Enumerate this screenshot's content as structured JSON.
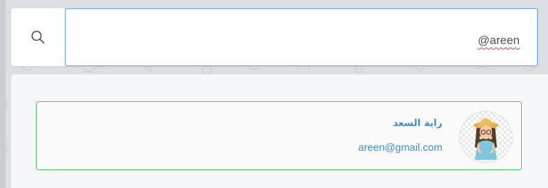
{
  "search": {
    "query": "@areen",
    "icon": "search-icon"
  },
  "results": [
    {
      "name": "راية السعد",
      "email": "areen@gmail.com",
      "avatar_icon": "girl-avatar"
    }
  ],
  "colors": {
    "accent_blue": "#3d8fd6",
    "input_border": "#64a6e8",
    "selected_border": "#4cc66b",
    "spellcheck": "#e53935"
  }
}
